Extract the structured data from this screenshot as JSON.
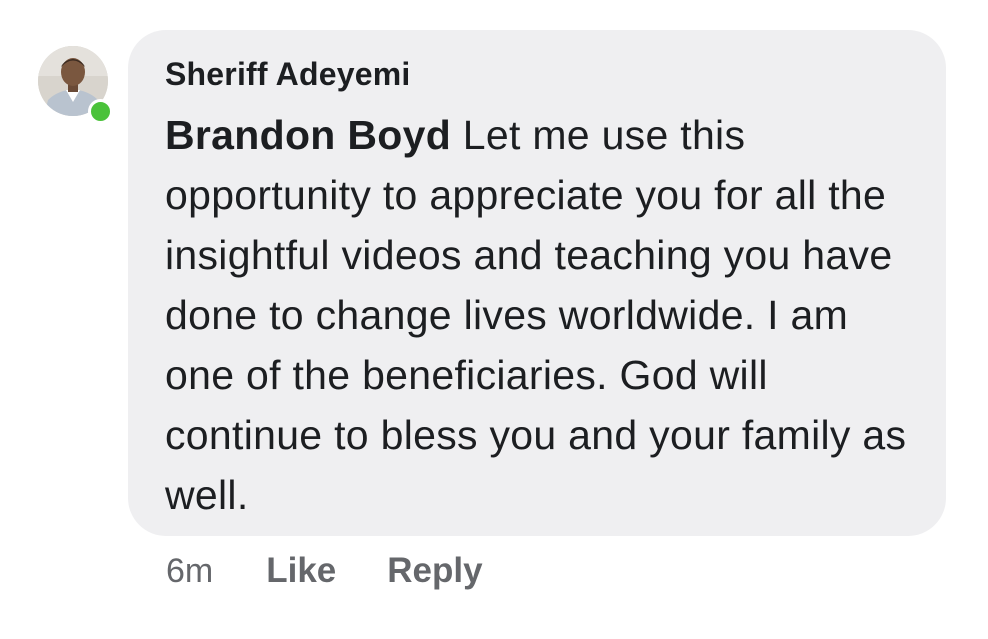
{
  "comment": {
    "author": "Sheriff Adeyemi",
    "mention": "Brandon Boyd",
    "text": " Let me use this opportunity to appreciate you for all the insightful videos and teaching you have done to change lives worldwide. I am one of the beneficiaries. God will continue to bless you and your family as well.",
    "online": true
  },
  "actions": {
    "time": "6m",
    "like_label": "Like",
    "reply_label": "Reply"
  },
  "colors": {
    "bubble_bg": "#efeff1",
    "text": "#1c1e21",
    "secondary_text": "#65676b",
    "online_dot": "#4ac23a"
  }
}
